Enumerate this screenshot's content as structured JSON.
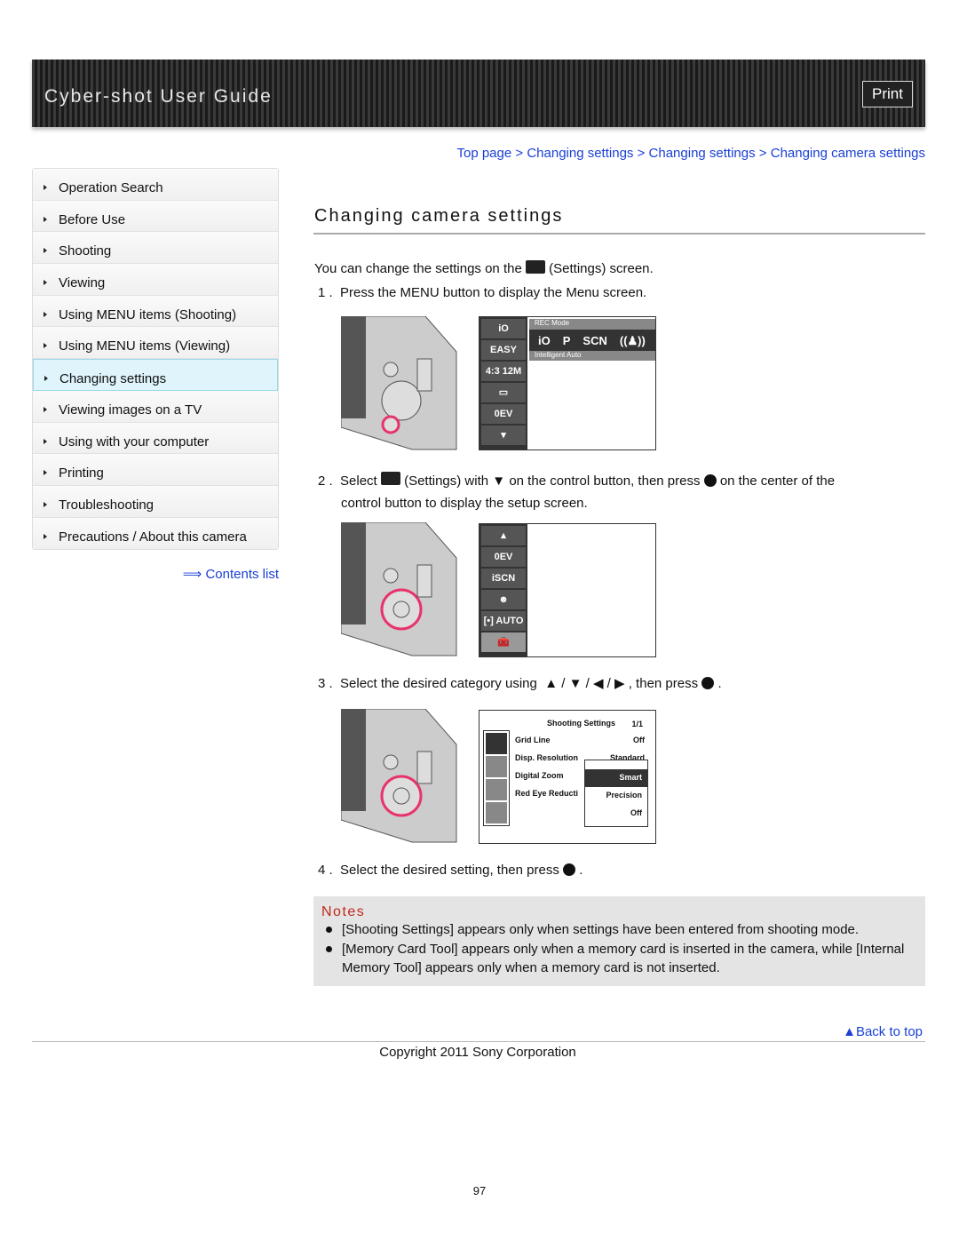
{
  "header": {
    "title": "Cyber-shot User Guide",
    "print_label": "Print"
  },
  "breadcrumb": [
    "Top page",
    "Changing settings",
    "Changing settings",
    "Changing camera settings"
  ],
  "breadcrumb_sep": ">",
  "sidebar": {
    "items": [
      {
        "label": "Operation Search"
      },
      {
        "label": "Before Use"
      },
      {
        "label": "Shooting"
      },
      {
        "label": "Viewing"
      },
      {
        "label": "Using MENU items (Shooting)"
      },
      {
        "label": "Using MENU items (Viewing)"
      },
      {
        "label": "Changing settings",
        "active": true
      },
      {
        "label": "Viewing images on a TV"
      },
      {
        "label": "Using with your computer"
      },
      {
        "label": "Printing"
      },
      {
        "label": "Troubleshooting"
      },
      {
        "label": "Precautions / About this camera"
      }
    ],
    "contents_link": "Contents list"
  },
  "main": {
    "title": "Changing camera settings",
    "intro_a": "You can change the settings on the",
    "intro_b": "(Settings) screen.",
    "steps": [
      {
        "num": "1 .",
        "text": "Press the MENU button to display the Menu screen."
      },
      {
        "num": "2 .",
        "a": "Select",
        "b": "(Settings) with",
        "c": "on the control button, then press",
        "d": "on the center of the",
        "e": "control button to display the setup screen."
      },
      {
        "num": "3 .",
        "a": "Select the desired category using",
        "sep": "/",
        "b": ", then press",
        "c": "."
      },
      {
        "num": "4 .",
        "a": "Select the desired setting, then press",
        "b": "."
      }
    ],
    "screen1": {
      "side": [
        "iO",
        "EASY",
        "4:3 12M",
        "▭",
        "0EV",
        "▾"
      ],
      "header": "REC Mode",
      "modes": [
        "iO",
        "P",
        "SCN",
        "((♟))"
      ],
      "sub": "Intelligent Auto"
    },
    "screen2": {
      "side": [
        "▴",
        "0EV",
        "iSCN",
        "☻",
        "[•] AUTO",
        "🧰"
      ]
    },
    "screen3": {
      "title": "Shooting Settings",
      "page": "1/1",
      "rows": [
        {
          "label": "Grid Line",
          "value": "Off"
        },
        {
          "label": "Disp. Resolution",
          "value": "Standard"
        },
        {
          "label": "Digital Zoom",
          "value": ""
        },
        {
          "label": "Red Eye Reducti",
          "value": ""
        }
      ],
      "options": [
        "Smart",
        "Precision",
        "Off"
      ]
    }
  },
  "notes": {
    "title": "Notes",
    "items": [
      "[Shooting Settings] appears only when settings have been entered from shooting mode.",
      "[Memory Card Tool] appears only when a memory card is inserted in the camera, while [Internal Memory Tool] appears only when a memory card is not inserted."
    ]
  },
  "footer": {
    "back_to_top": "Back to top",
    "copyright": "Copyright 2011 Sony Corporation",
    "page_number": "97"
  },
  "colors": {
    "link": "#1a3fd6",
    "notes_title": "#c0281c",
    "highlight": "#e8336b"
  }
}
